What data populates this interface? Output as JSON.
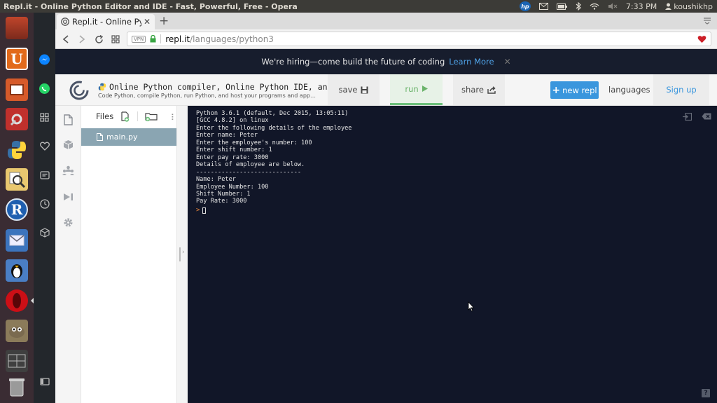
{
  "system_bar": {
    "window_title": "Repl.it - Online Python Editor and IDE - Fast, Powerful, Free - Opera",
    "time": "7:33 PM",
    "user": "koushikhp",
    "hp_label": "hp"
  },
  "launcher": {
    "items": [
      "files-app",
      "ubuntu-software",
      "impress",
      "system-settings",
      "python",
      "search-tool",
      "r-lang",
      "mail",
      "gimp-penguin",
      "opera",
      "gimp",
      "workspace-switcher",
      "trash"
    ],
    "u_letter": "U",
    "r_letter": "R"
  },
  "browser": {
    "tab_title": "Repl.it - Online Pytho",
    "url_host": "repl.it",
    "url_path": "/languages/python3",
    "vpn_label": "VPN",
    "colors": {
      "opera_red": "#cc0f16",
      "accent_blue": "#3a96dd"
    }
  },
  "banner": {
    "text": "We're hiring—come build the future of coding",
    "link": "Learn More"
  },
  "header": {
    "title": "Online Python compiler, Online Python IDE, an…",
    "subtitle": "Code Python, compile Python, run Python, and host your programs and app…",
    "save_label": "save",
    "run_label": "run",
    "share_label": "share",
    "new_repl_label": "new repl",
    "languages_label": "languages",
    "signup_label": "Sign up"
  },
  "files": {
    "header": "Files",
    "items": [
      {
        "name": "main.py"
      }
    ]
  },
  "console": {
    "lines": [
      "Python 3.6.1 (default, Dec 2015, 13:05:11)",
      "[GCC 4.8.2] on linux",
      "Enter the following details of the employee",
      "Enter name: Peter",
      "Enter the employee's number: 100",
      "Enter shift number: 1",
      "Enter pay rate: 3000",
      "Details of employee are below.",
      "-----------------------------",
      "Name: Peter",
      "Employee Number: 100",
      "Shift Number: 1",
      "Pay Rate: 3000"
    ],
    "prompt": ">",
    "help_label": "?"
  }
}
